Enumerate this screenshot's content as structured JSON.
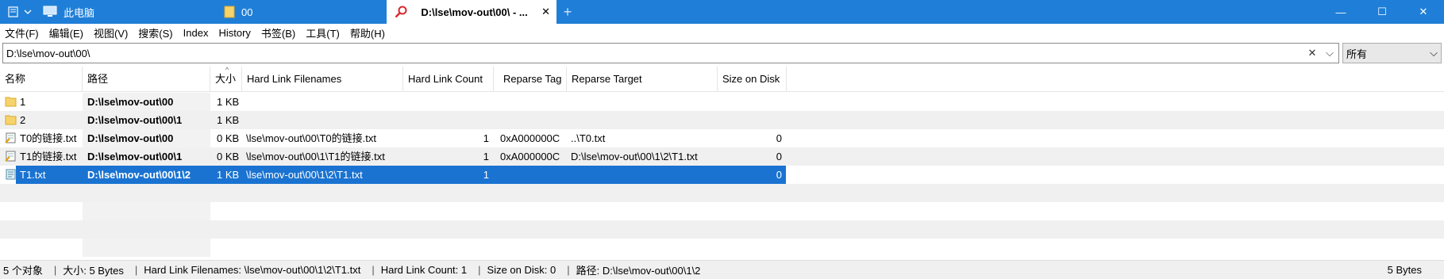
{
  "titlebar": {
    "tabs": [
      {
        "label": "此电脑"
      },
      {
        "label": "00"
      },
      {
        "label": "D:\\lse\\mov-out\\00\\ - ...",
        "close": "✕"
      }
    ],
    "new_tab": "+",
    "controls": {
      "minimize": "—",
      "maximize": "☐",
      "close": "✕"
    }
  },
  "menu": [
    "文件(F)",
    "编辑(E)",
    "视图(V)",
    "搜索(S)",
    "Index",
    "History",
    "书签(B)",
    "工具(T)",
    "帮助(H)"
  ],
  "address": {
    "value": "D:\\lse\\mov-out\\00\\",
    "clear": "✕",
    "dropdown": "⌵"
  },
  "filter": {
    "value": "所有",
    "arrow": "⌵"
  },
  "columns": [
    "名称",
    "路径",
    "大小",
    "Hard Link Filenames",
    "Hard Link Count",
    "Reparse Tag",
    "Reparse Target",
    "Size on Disk"
  ],
  "sort_indicator": "^",
  "rows": [
    {
      "name": "1",
      "path": "D:\\lse\\mov-out\\00",
      "size": "1 KB",
      "hardlinks": "",
      "hlcount": "",
      "tag": "",
      "target": "",
      "disk": "",
      "icon": "folder-icon"
    },
    {
      "name": "2",
      "path": "D:\\lse\\mov-out\\00\\1",
      "size": "1 KB",
      "hardlinks": "",
      "hlcount": "",
      "tag": "",
      "target": "",
      "disk": "",
      "icon": "folder-icon"
    },
    {
      "name": "T0的链接.txt",
      "path": "D:\\lse\\mov-out\\00",
      "size": "0 KB",
      "hardlinks": "\\lse\\mov-out\\00\\T0的链接.txt",
      "hlcount": "1",
      "tag": "0xA000000C",
      "target": "..\\T0.txt",
      "disk": "0",
      "icon": "symlink-file-icon"
    },
    {
      "name": "T1的链接.txt",
      "path": "D:\\lse\\mov-out\\00\\1",
      "size": "0 KB",
      "hardlinks": "\\lse\\mov-out\\00\\1\\T1的链接.txt",
      "hlcount": "1",
      "tag": "0xA000000C",
      "target": "D:\\lse\\mov-out\\00\\1\\2\\T1.txt",
      "disk": "0",
      "icon": "symlink-file-icon"
    },
    {
      "name": "T1.txt",
      "path": "D:\\lse\\mov-out\\00\\1\\2",
      "size": "1 KB",
      "hardlinks": "\\lse\\mov-out\\00\\1\\2\\T1.txt",
      "hlcount": "1",
      "tag": "",
      "target": "",
      "disk": "0",
      "icon": "text-file-icon",
      "selected": true
    }
  ],
  "status": {
    "count": "5 个对象",
    "size": "大小: 5 Bytes",
    "hardlinks": "Hard Link Filenames: \\lse\\mov-out\\00\\1\\2\\T1.txt",
    "hlcount": "Hard Link Count: 1",
    "disk": "Size on Disk: 0",
    "path": "路径: D:\\lse\\mov-out\\00\\1\\2",
    "right": "5 Bytes"
  },
  "colors": {
    "titlebar": "#1f7fd8",
    "selection": "#1a73d1",
    "folder": "#f7d36b"
  }
}
